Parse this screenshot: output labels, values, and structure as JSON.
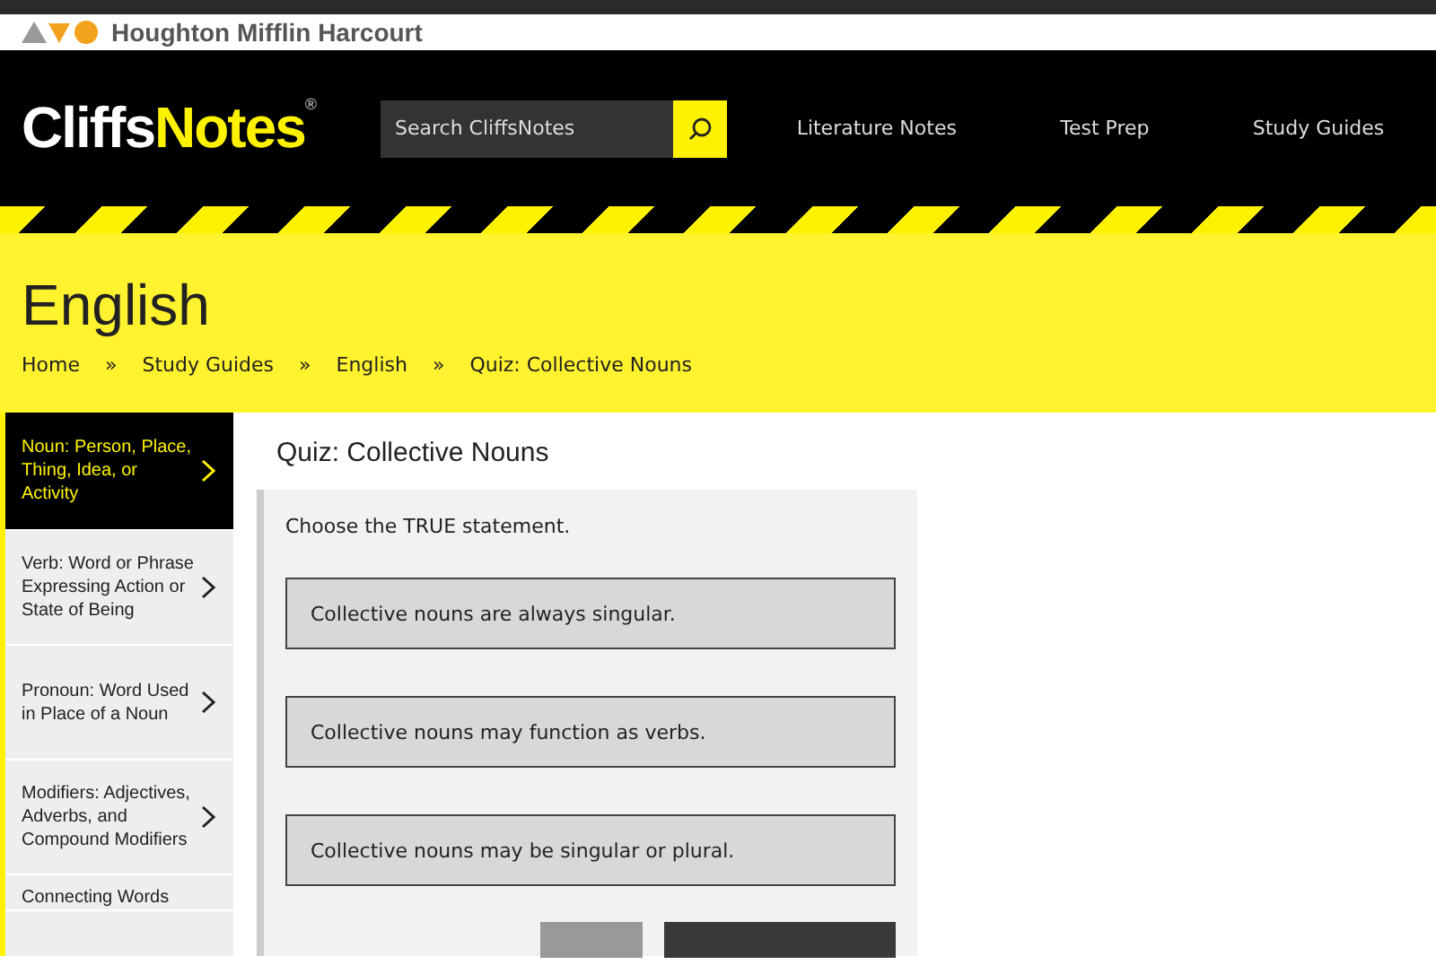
{
  "publisher": {
    "name": "Houghton Mifflin Harcourt"
  },
  "header": {
    "logo_left": "Cliffs",
    "logo_right": "Notes",
    "logo_mark": "®",
    "search": {
      "placeholder": "Search CliffsNotes"
    },
    "nav": [
      "Literature Notes",
      "Test Prep",
      "Study Guides"
    ]
  },
  "banner": {
    "title": "English",
    "breadcrumb": [
      "Home",
      "Study Guides",
      "English",
      "Quiz: Collective Nouns"
    ],
    "separator": "»"
  },
  "sidebar": {
    "items": [
      {
        "label": "Noun: Person, Place, Thing, Idea, or Activity",
        "selected": true
      },
      {
        "label": "Verb: Word or Phrase Expressing Action or State of Being",
        "selected": false
      },
      {
        "label": "Pronoun: Word Used in Place of a Noun",
        "selected": false
      },
      {
        "label": "Modifiers: Adjectives, Adverbs, and Compound Modifiers",
        "selected": false
      },
      {
        "label": "Connecting Words",
        "selected": false
      }
    ]
  },
  "quiz": {
    "title": "Quiz: Collective Nouns",
    "question": "Choose the TRUE statement.",
    "choices": [
      "Collective nouns are always singular.",
      "Collective nouns may function as verbs.",
      "Collective nouns may be singular or plural."
    ],
    "buttons": [
      {
        "kind": "secondary"
      },
      {
        "kind": "primary"
      }
    ]
  }
}
